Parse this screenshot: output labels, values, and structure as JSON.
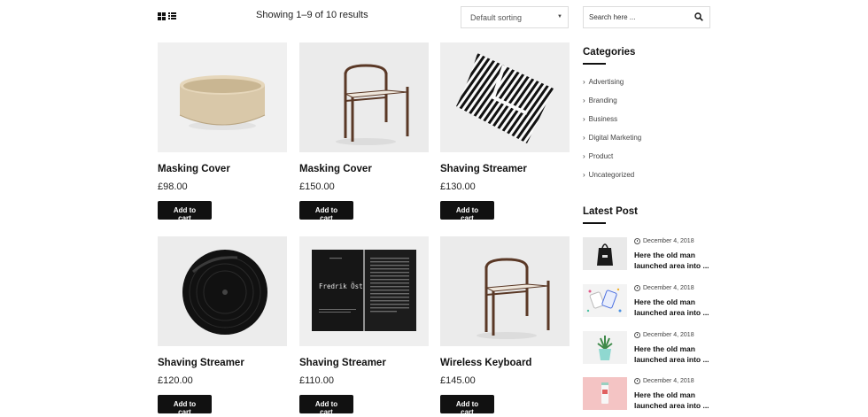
{
  "toolbar": {
    "result_count": "Showing 1–9 of 10 results",
    "sort_selected": "Default sorting",
    "search_placeholder": "Search here ..."
  },
  "products": [
    {
      "name": "Masking Cover",
      "price": "£98.00",
      "button": "Add to cart",
      "image": "bowl"
    },
    {
      "name": "Masking Cover",
      "price": "£150.00",
      "button": "Add to cart",
      "image": "chair"
    },
    {
      "name": "Shaving Streamer",
      "price": "£130.00",
      "button": "Add to cart",
      "image": "pattern-paper"
    },
    {
      "name": "Shaving Streamer",
      "price": "£120.00",
      "button": "Add to cart",
      "image": "vinyl-record"
    },
    {
      "name": "Shaving Streamer",
      "price": "£110.00",
      "button": "Add to cart",
      "image": "book",
      "image_text": "Fredrik Öst"
    },
    {
      "name": "Wireless Keyboard",
      "price": "£145.00",
      "button": "Add to cart",
      "image": "chair"
    }
  ],
  "sidebar": {
    "categories_title": "Categories",
    "categories": [
      "Advertising",
      "Branding",
      "Business",
      "Digital Marketing",
      "Product",
      "Uncategorized"
    ],
    "latest_title": "Latest Post",
    "posts": [
      {
        "date": "December 4, 2018",
        "title": "Here the old man launched area into ..."
      },
      {
        "date": "December 4, 2018",
        "title": "Here the old man launched area into ..."
      },
      {
        "date": "December 4, 2018",
        "title": "Here the old man launched area into ..."
      },
      {
        "date": "December 4, 2018",
        "title": "Here the old man launched area into ..."
      }
    ]
  },
  "colors": {
    "button_bg": "#111111",
    "text": "#222222",
    "thumb_bg": "#f1f1f1"
  }
}
